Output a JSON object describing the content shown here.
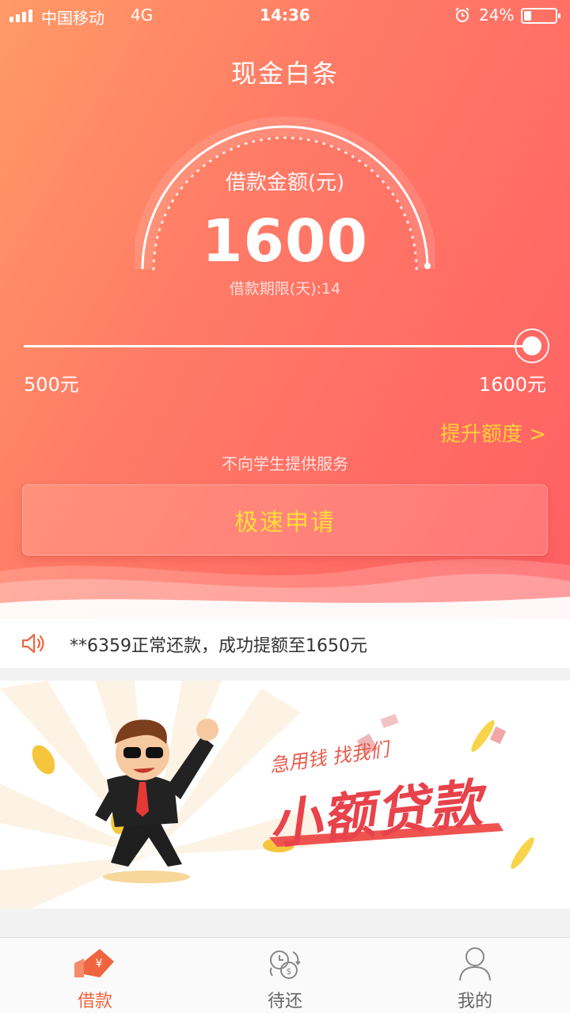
{
  "status_bar": {
    "carrier": "中国移动",
    "network": "4G",
    "time": "14:36",
    "battery_text": "24%",
    "battery_level": 0.24
  },
  "header": {
    "title": "现金白条"
  },
  "loan": {
    "amount_label": "借款金额(元)",
    "amount": "1600",
    "term_label": "借款期限(天):14",
    "slider": {
      "min_label": "500元",
      "max_label": "1600元",
      "min": 500,
      "max": 1600,
      "value": 1600
    },
    "raise_limit_label": "提升额度 >",
    "notice": "不向学生提供服务",
    "apply_label": "极速申请"
  },
  "ticker": {
    "message": "**6359正常还款，成功提额至1650元"
  },
  "banner": {
    "subtitle": "急用钱 找我们",
    "title": "小额贷款"
  },
  "tabbar": {
    "items": [
      {
        "label": "借款",
        "icon": "loan-icon",
        "active": true
      },
      {
        "label": "待还",
        "icon": "repay-icon",
        "active": false
      },
      {
        "label": "我的",
        "icon": "profile-icon",
        "active": false
      }
    ]
  },
  "colors": {
    "hero_start": "#ff9a66",
    "hero_end": "#ff5f63",
    "accent_yellow": "#ffd23a",
    "tab_active": "#f0653f"
  }
}
